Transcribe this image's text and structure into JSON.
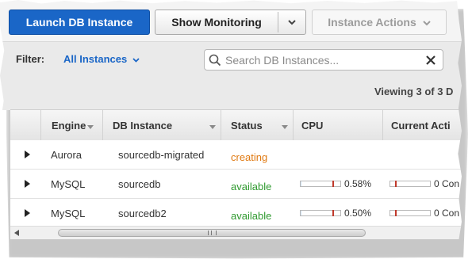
{
  "toolbar": {
    "launch_label": "Launch DB Instance",
    "monitoring_label": "Show Monitoring",
    "actions_label": "Instance Actions"
  },
  "filter": {
    "label": "Filter:",
    "selected": "All Instances",
    "search_placeholder": "Search DB Instances..."
  },
  "viewing_text": "Viewing 3 of 3 D",
  "table": {
    "columns": [
      "Engine",
      "DB Instance",
      "Status",
      "CPU",
      "Current Acti"
    ],
    "rows": [
      {
        "engine": "Aurora",
        "instance": "sourcedb-migrated",
        "status": "creating",
        "cpu": "",
        "activity": ""
      },
      {
        "engine": "MySQL",
        "instance": "sourcedb",
        "status": "available",
        "cpu": "0.58%",
        "cpu_fraction": 0.0058,
        "activity": "0 Con"
      },
      {
        "engine": "MySQL",
        "instance": "sourcedb2",
        "status": "available",
        "cpu": "0.50%",
        "cpu_fraction": 0.005,
        "activity": "0 Con"
      }
    ]
  },
  "colors": {
    "primary": "#1a66c7",
    "status_creating": "#e07a12",
    "status_available": "#2f9a2f"
  }
}
